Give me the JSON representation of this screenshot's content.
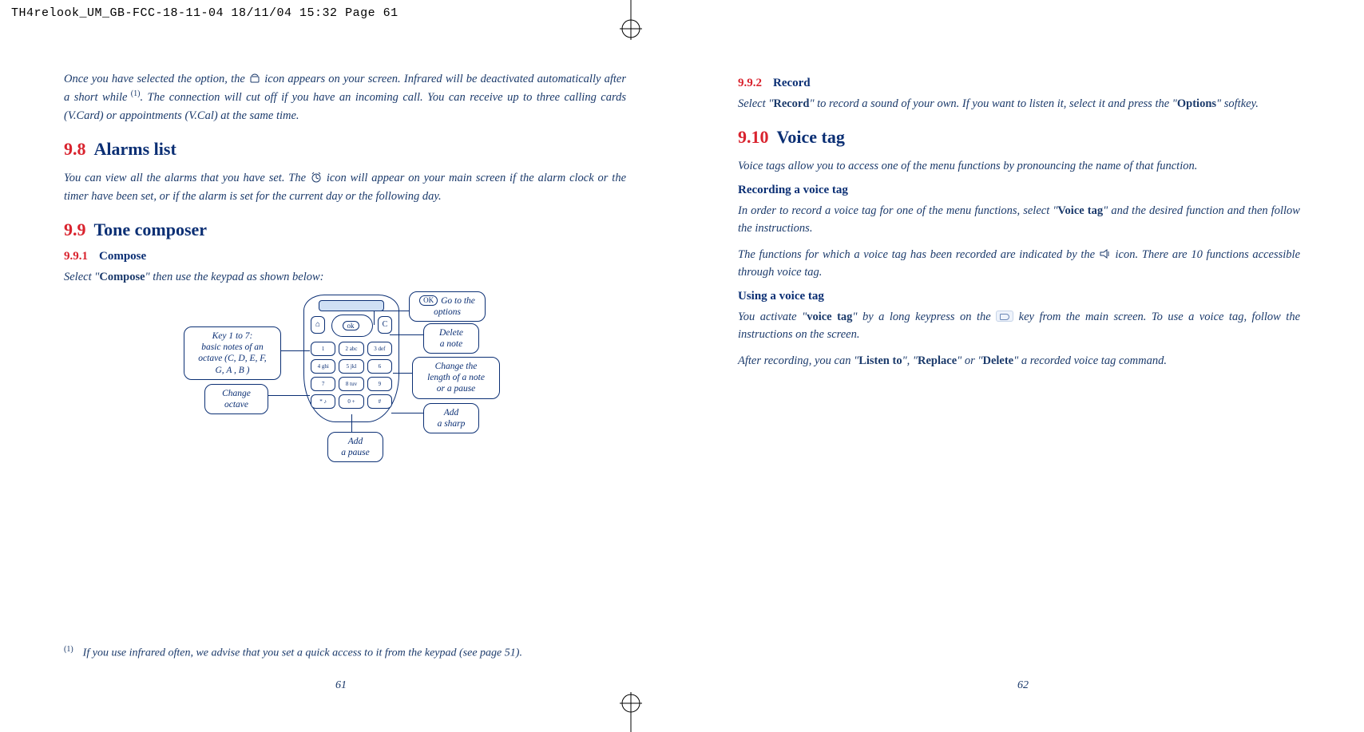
{
  "slug": "TH4relook_UM_GB-FCC-18-11-04   18/11/04   15:32   Page 61",
  "left": {
    "intro": "Once you have selected the option, the     icon appears on your screen. Infrared will be deactivated automatically after a short while (1). The connection will cut off if you have an incoming call. You can receive up to three calling cards (V.Card) or appointments (V.Cal) at the same time.",
    "sec98_num": "9.8",
    "sec98_title": "Alarms list",
    "sec98_body": "You can view all the alarms that you have set. The     icon will appear on your main screen if the alarm clock or the timer have been set, or if the alarm is set for the current day or the following day.",
    "sec99_num": "9.9",
    "sec99_title": "Tone composer",
    "sub991_num": "9.9.1",
    "sub991_title": "Compose",
    "sub991_body_a": "Select \"",
    "sub991_body_bold": "Compose",
    "sub991_body_b": "\" then use the keypad as shown below:",
    "callouts": {
      "k17_l1": "Key 1 to 7:",
      "k17_l2": "basic notes of an",
      "k17_l3": "octave (C, D, E, F,",
      "k17_l4": "G, A , B )",
      "chg_oct_l1": "Change",
      "chg_oct_l2": "octave",
      "goto_l1": "Go to the",
      "goto_l2": "options",
      "del_l1": "Delete",
      "del_l2": "a note",
      "len_l1": "Change the",
      "len_l2": "length of a note",
      "len_l3": "or a pause",
      "sharp_l1": "Add",
      "sharp_l2": "a sharp",
      "pause_l1": "Add",
      "pause_l2": "a pause",
      "ok_label": "OK"
    },
    "footnote_sup": "(1)",
    "footnote": "If you use infrared often, we advise that you set a quick access to it from the keypad (see page 51).",
    "pagenum": "61"
  },
  "right": {
    "sub992_num": "9.9.2",
    "sub992_title": "Record",
    "sub992_a": "Select \"",
    "sub992_bold1": "Record",
    "sub992_b": "\" to record a sound of your own. If you want to listen it, select it and press the \"",
    "sub992_bold2": "Options",
    "sub992_c": "\" softkey.",
    "sec910_num": "9.10",
    "sec910_title": "Voice tag",
    "sec910_body": "Voice tags allow you to access one of the menu functions by pronouncing the name of that function.",
    "recv_title": "Recording a voice tag",
    "recv_a": "In order to record a voice tag for one of the menu functions, select \"",
    "recv_bold": "Voice tag",
    "recv_b": "\" and the desired function and then follow the instructions.",
    "recv_c": "The functions for which a voice tag has been recorded are indicated by the     icon. There are 10 functions accessible through voice tag.",
    "usev_title": "Using a voice tag",
    "usev_a": "You activate \"",
    "usev_bold": "voice tag",
    "usev_b": "\" by a long keypress on the     key from the main screen. To use a voice tag, follow the instructions on the screen.",
    "after_a": "After recording, you can \"",
    "after_b1": "Listen to",
    "after_m1": "\", \"",
    "after_b2": "Replace",
    "after_m2": "\" or \"",
    "after_b3": "Delete",
    "after_c": "\" a recorded voice tag command.",
    "pagenum": "62"
  }
}
